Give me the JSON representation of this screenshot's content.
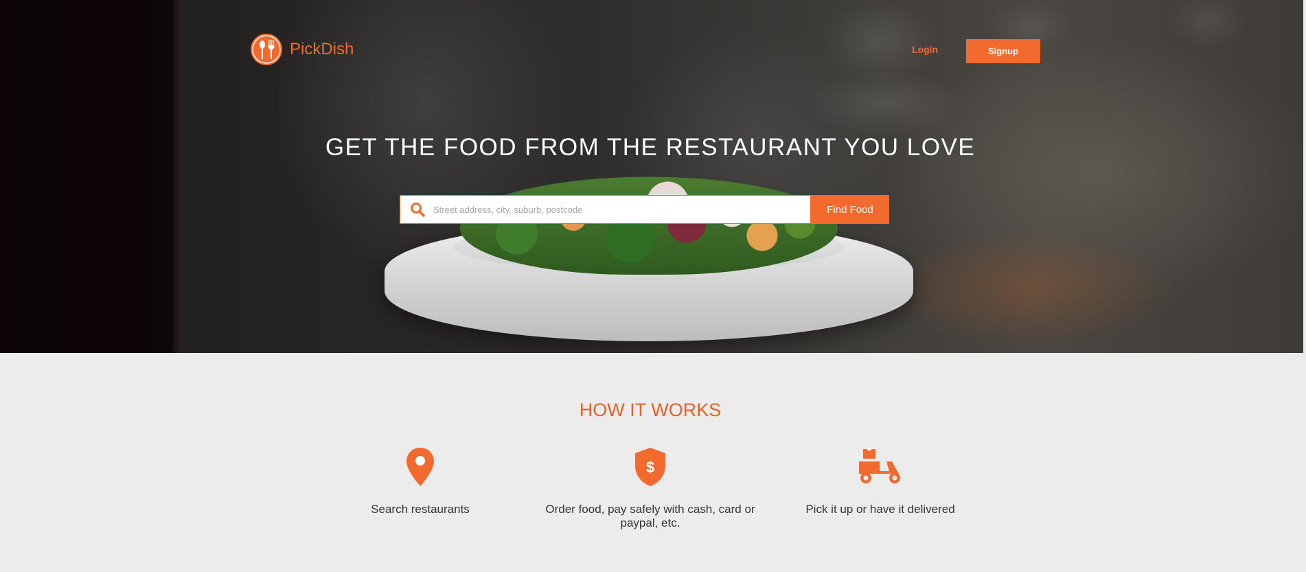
{
  "header": {
    "brand": "PickDish",
    "logo_icon": "spoon-fork-logo-icon",
    "login_label": "Login",
    "signup_label": "Signup"
  },
  "hero": {
    "headline": "GET THE FOOD FROM THE RESTAURANT YOU LOVE",
    "search": {
      "icon": "search-icon",
      "placeholder": "Street address, city, suburb, postcode",
      "value": "",
      "button_label": "Find Food"
    }
  },
  "how_it_works": {
    "title": "HOW IT WORKS",
    "steps": [
      {
        "icon": "map-pin-icon",
        "text": "Search restaurants"
      },
      {
        "icon": "dollar-shield-icon",
        "text": "Order food, pay safely with cash, card or paypal, etc."
      },
      {
        "icon": "delivery-scooter-icon",
        "text": "Pick it up or have it delivered"
      }
    ]
  },
  "colors": {
    "accent": "#f26a2e",
    "page_background": "#ececec",
    "headline": "#ffffff"
  }
}
